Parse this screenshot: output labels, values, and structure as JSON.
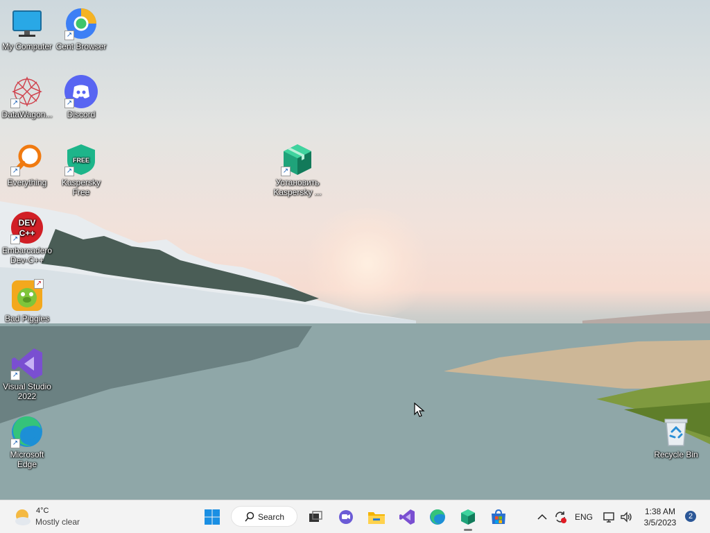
{
  "desktop": {
    "icons": [
      {
        "label": "My Computer"
      },
      {
        "label": "Cent Browser"
      },
      {
        "label": "DataWagon..."
      },
      {
        "label": "Discord"
      },
      {
        "label": "Everything"
      },
      {
        "label": "Kaspersky Free"
      },
      {
        "label": "Установить Kaspersky ..."
      },
      {
        "label": "Embarcadero Dev-C++"
      },
      {
        "label": "Bad Piggies"
      },
      {
        "label": "Visual Studio 2022"
      },
      {
        "label": "Microsoft Edge"
      },
      {
        "label": "Recycle Bin"
      }
    ],
    "devcpp_logo_text": "DEV C++",
    "kaspersky_badge": "FREE"
  },
  "taskbar": {
    "weather": {
      "temp": "4°C",
      "condition": "Mostly clear"
    },
    "search_label": "Search",
    "language": "ENG",
    "clock": {
      "time": "1:38 AM",
      "date": "3/5/2023"
    },
    "notification_count": "2"
  }
}
